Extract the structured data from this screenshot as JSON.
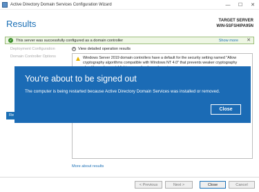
{
  "window": {
    "title": "Active Directory Domain Services Configuration Wizard",
    "controls": [
      "—",
      "☐",
      "✕"
    ]
  },
  "header": {
    "page_title": "Results",
    "target_label": "TARGET SERVER",
    "target_name": "WIN-5SFSHIPA95N"
  },
  "banner": {
    "message": "This server was successfully configured as a domain controller",
    "show_more": "Show more",
    "close": "✕"
  },
  "sidebar": {
    "items": [
      {
        "label": "Deployment Configuration"
      },
      {
        "label": "Domain Controller Options"
      }
    ],
    "active_label": "Re"
  },
  "content": {
    "expander_label": "View detailed operation results",
    "warning_text": "Windows Server 2019 domain controllers have a default for the security setting named \"Allow cryptography algorithms compatible with Windows NT 4.0\" that prevents weaker cryptography algorithms when establishing security channel sessions.",
    "more_link": "More about results"
  },
  "footer": {
    "previous": "< Previous",
    "next": "Next >",
    "close": "Close",
    "cancel": "Cancel"
  },
  "dialog": {
    "title": "You're about to be signed out",
    "message": "The computer is being restarted because Active Directory Domain Services was installed or removed.",
    "button": "Close"
  },
  "colors": {
    "accent": "#1a6fb5",
    "dialog_bg": "#1b6bb5",
    "success": "#3b8e2b",
    "warning": "#e6b400"
  }
}
